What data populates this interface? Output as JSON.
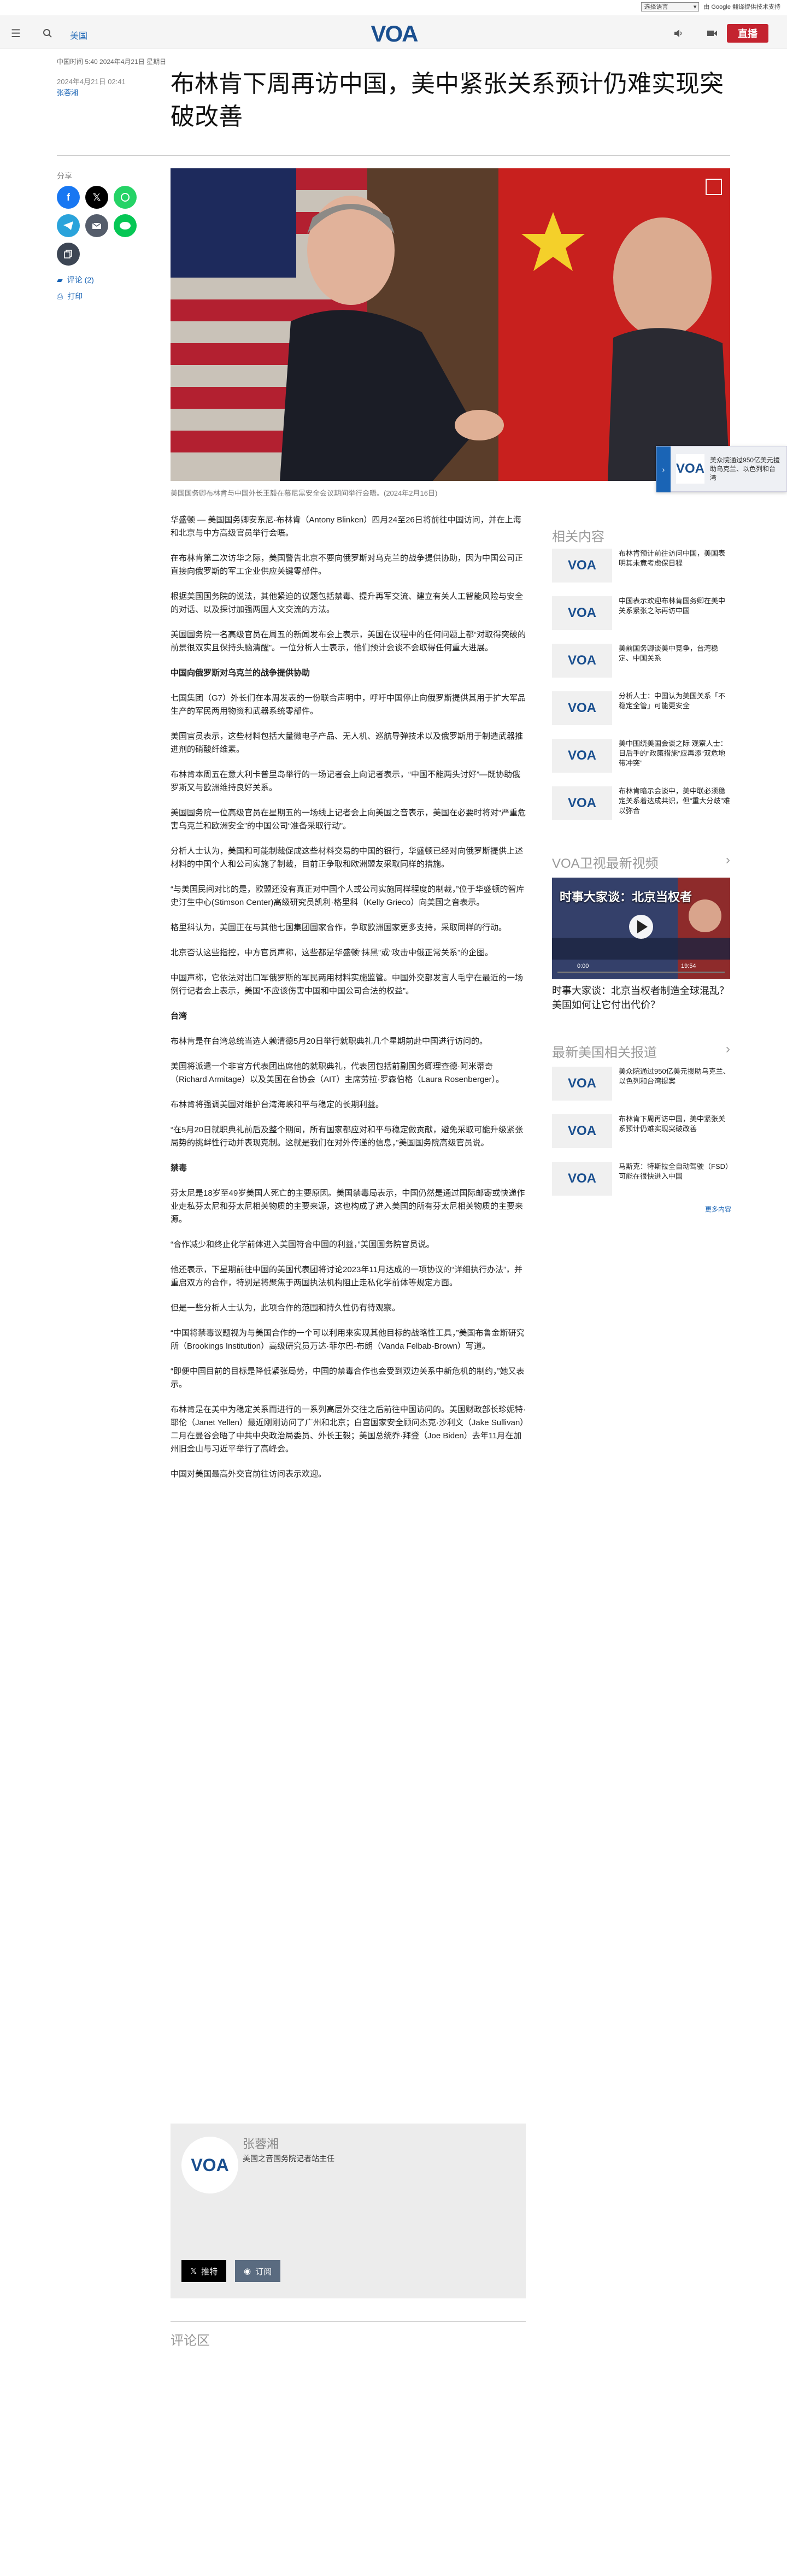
{
  "topbar": {
    "language_selected": "选择语言",
    "powered": "由 Google 翻译提供技术支持"
  },
  "header": {
    "category": "美国",
    "live_label": "直播"
  },
  "breadcrumb": "中国时间 5:40 2024年4月21日 星期日",
  "article": {
    "date": "2024年4月21日 02:41",
    "author": "张蓉湘",
    "title": "布林肯下周再访中国，美中紧张关系预计仍难实现突破改善",
    "caption": "美国国务卿布林肯与中国外长王毅在慕尼黑安全会议期间举行会晤。(2024年2月16日)",
    "paragraphs": [
      {
        "type": "p",
        "text": "华盛顿 — 美国国务卿安东尼·布林肯（Antony Blinken）四月24至26日将前往中国访问，并在上海和北京与中方高级官员举行会晤。"
      },
      {
        "type": "p",
        "text": "在布林肯第二次访华之际，美国警告北京不要向俄罗斯对乌克兰的战争提供协助，因为中国公司正直接向俄罗斯的军工企业供应关键零部件。"
      },
      {
        "type": "p",
        "text": "根据美国国务院的说法，其他紧迫的议题包括禁毒、提升再军交流、建立有关人工智能风险与安全的对话、以及探讨加强两国人文交流的方法。"
      },
      {
        "type": "p",
        "text": "美国国务院一名高级官员在周五的新闻发布会上表示，美国在议程中的任何问题上都“对取得突破的前景很双实且保持头脑清醒”。一位分析人士表示，他们预计会谈不会取得任何重大进展。"
      },
      {
        "type": "h",
        "text": "中国向俄罗斯对乌克兰的战争提供协助"
      },
      {
        "type": "p",
        "text": "七国集团（G7）外长们在本周发表的一份联合声明中，呼吁中国停止向俄罗斯提供其用于扩大军品生产的军民两用物资和武器系统零部件。"
      },
      {
        "type": "p",
        "text": "美国官员表示，这些材料包括大量微电子产品、无人机、巡航导弹技术以及俄罗斯用于制造武器推进剂的硝酸纤维素。"
      },
      {
        "type": "p",
        "text": "布林肯本周五在意大利卡普里岛举行的一场记者会上向记者表示，“中国不能两头讨好”—既协助俄罗斯又与欧洲维持良好关系。"
      },
      {
        "type": "p",
        "text": "美国国务院一位高级官员在星期五的一场线上记者会上向美国之音表示，美国在必要时将对“严重危害乌克兰和欧洲安全”的中国公司“准备采取行动”。"
      },
      {
        "type": "p",
        "text": "分析人士认为，美国和可能制裁促成这些材料交易的中国的银行，华盛顿已经对向俄罗斯提供上述材料的中国个人和公司实施了制裁，目前正争取和欧洲盟友采取同样的措施。"
      },
      {
        "type": "p",
        "text": "“与美国民间对比的是，欧盟还没有真正对中国个人或公司实施同样程度的制裁，”位于华盛顿的智库史汀生中心(Stimson Center)高级研究员凯利·格里科（Kelly Grieco）向美国之音表示。"
      },
      {
        "type": "p",
        "text": "格里科认为，美国正在与其他七国集团国家合作，争取欧洲国家更多支持，采取同样的行动。"
      },
      {
        "type": "p",
        "text": "北京否认这些指控，中方官员声称，这些都是华盛顿“抹黑”或“攻击中俄正常关系”的企图。"
      },
      {
        "type": "p",
        "text": "中国声称，它依法对出口军俄罗斯的军民两用材料实施监管。中国外交部发言人毛宁在最近的一场例行记者会上表示，美国“不应该伤害中国和中国公司合法的权益”。"
      },
      {
        "type": "h",
        "text": "台湾"
      },
      {
        "type": "p",
        "text": "布林肯是在台湾总统当选人赖清德5月20日举行就职典礼几个星期前赴中国进行访问的。"
      },
      {
        "type": "p",
        "text": "美国将派遣一个非官方代表团出席他的就职典礼，代表团包括前副国务卿理查德·阿米蒂奇（Richard Armitage）以及美国在台协会（AIT）主席劳拉·罗森伯格（Laura Rosenberger）。"
      },
      {
        "type": "p",
        "text": "布林肯将强调美国对维护台湾海峡和平与稳定的长期利益。"
      },
      {
        "type": "p",
        "text": "“在5月20日就职典礼前后及整个期间，所有国家都应对和平与稳定做贡献，避免采取可能升级紧张局势的挑衅性行动并表现克制。这就是我们在对外传递的信息，”美国国务院高级官员说。"
      },
      {
        "type": "h",
        "text": "禁毒"
      },
      {
        "type": "p",
        "text": "芬太尼是18岁至49岁美国人死亡的主要原因。美国禁毒局表示，中国仍然是通过国际邮寄或快递作业走私芬太尼和芬太尼相关物质的主要来源，这也构成了进入美国的所有芬太尼相关物质的主要来源。"
      },
      {
        "type": "p",
        "text": "“合作减少和终止化学前体进入美国符合中国的利益，”美国国务院官员说。"
      },
      {
        "type": "p",
        "text": "他还表示，下星期前往中国的美国代表团将讨论2023年11月达成的一项协议的“详细执行办法”，并重启双方的合作，特别是将聚焦于两国执法机构阻止走私化学前体等规定方面。"
      },
      {
        "type": "p",
        "text": "但是一些分析人士认为，此项合作的范围和持久性仍有待观察。"
      },
      {
        "type": "p",
        "text": "“中国将禁毒议题视为与美国合作的一个可以利用来实现其他目标的战略性工具，”美国布鲁金斯研究所（Brookings Institution）高级研究员万达·菲尔巴-布朗（Vanda Felbab-Brown）写道。"
      },
      {
        "type": "p",
        "text": "“即便中国目前的目标是降低紧张局势，中国的禁毒合作也会受到双边关系中新危机的制约，”她又表示。"
      },
      {
        "type": "p",
        "text": "布林肯是在美中为稳定关系而进行的一系列高层外交往之后前往中国访问的。美国财政部长珍妮特·耶伦（Janet Yellen）最近刚刚访问了广州和北京；白宫国家安全顾问杰克·沙利文（Jake Sullivan）二月在曼谷会晤了中共中央政治局委员、外长王毅；美国总统乔·拜登（Joe Biden）去年11月在加州旧金山与习近平举行了高峰会。"
      },
      {
        "type": "p",
        "text": "中国对美国最高外交官前往访问表示欢迎。"
      }
    ]
  },
  "share": {
    "label": "分享",
    "comments": "评论 (2)",
    "print": "打印"
  },
  "author_box": {
    "name": "张蓉湘",
    "role": "美国之音国务院记者站主任",
    "follow": "推特",
    "subscribe": "订阅"
  },
  "comments_title": "评论区",
  "floating_card": {
    "text": "美众院通过950亿美元援助乌克兰、以色列和台湾"
  },
  "related": {
    "title": "相关内容",
    "items": [
      "布林肯预计前往访问中国，美国表明其未竟考虑保日程",
      "中国表示欢迎布林肯国务卿在美中关系紧张之际再访中国",
      "美前国务卿谈美中竞争，台湾稳定、中国关系",
      "分析人士：中国认为美国关系「不稳定全管」可能更安全",
      "美中围绕美国会谈之际 观察人士：日后手的“政策措施”应再添“双危地带冲突”",
      "布林肯暗示会谈中，美中联必须稳定关系着达成共识，但“重大分歧”难以弥合"
    ]
  },
  "video_section": {
    "title": "VOA卫视最新视频",
    "overlay": "时事大家谈：北京当权者",
    "video_title": "时事大家谈：北京当权者制造全球混乱？美国如何让它付出代价？",
    "time_current": "0:00",
    "time_total": "19:54"
  },
  "latest": {
    "title": "最新美国相关报道",
    "items": [
      "美众院通过950亿美元援助乌克兰、以色列和台湾提案",
      "布林肯下周再访中国，美中紧张关系预计仍难实现突破改善",
      "马斯克：特斯拉全自动驾驶（FSD）可能在很快进入中国"
    ],
    "more": "更多内容"
  },
  "colors": {
    "brand": "#1a64b5",
    "live": "#c4232f",
    "facebook": "#1877f2",
    "x": "#000000",
    "whatsapp": "#25d366",
    "telegram": "#2aa3db",
    "mail": "#555d6b",
    "line": "#06c755",
    "copy": "#3d4654"
  }
}
